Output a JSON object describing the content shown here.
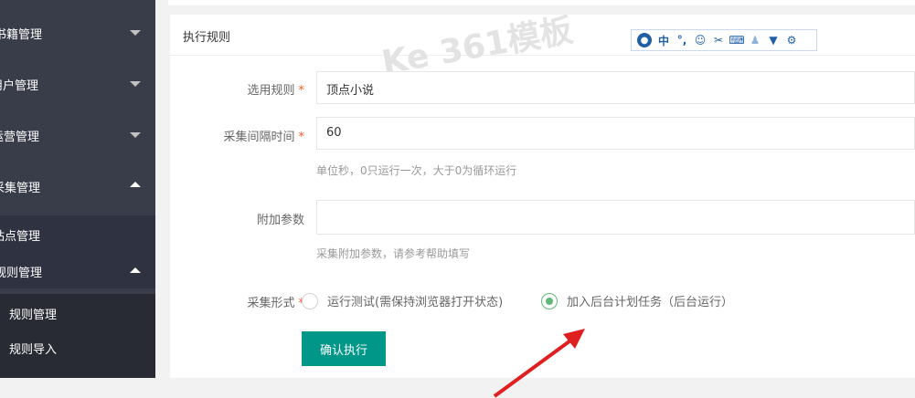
{
  "sidebar": {
    "items": [
      {
        "label": "书籍管理",
        "expanded": false
      },
      {
        "label": "用户管理",
        "expanded": false
      },
      {
        "label": "运营管理",
        "expanded": false
      },
      {
        "label": "采集管理",
        "expanded": true
      }
    ],
    "sub_items": [
      {
        "label": "站点管理"
      },
      {
        "label": "规则管理",
        "expanded": true
      }
    ],
    "nested_items": [
      {
        "label": "规则管理"
      },
      {
        "label": "规则导入"
      }
    ]
  },
  "card": {
    "title": "执行规则"
  },
  "watermark": "Ke 361模板",
  "toolbar": {
    "icons": [
      "avatar-icon",
      "chinese-char-icon",
      "punctuation-icon",
      "emoji-icon",
      "scissors-icon",
      "keyboard-icon",
      "user-icon",
      "shirt-icon",
      "gear-icon"
    ],
    "chars": {
      "chinese": "中"
    }
  },
  "form": {
    "rule_label": "选用规则",
    "rule_value": "顶点小说",
    "interval_label": "采集间隔时间",
    "interval_value": "60",
    "interval_help": "单位秒，0只运行一次，大于0为循环运行",
    "params_label": "附加参数",
    "params_value": "",
    "params_help": "采集附加参数，请参考帮助填写",
    "mode_label": "采集形式",
    "modes": [
      {
        "label": "运行测试(需保持浏览器打开状态)",
        "checked": false
      },
      {
        "label": "加入后台计划任务（后台运行）",
        "checked": true
      }
    ],
    "required_mark": "*",
    "submit_label": "确认执行"
  },
  "colors": {
    "sidebar": "#393d49",
    "accent": "#009688",
    "radio_checked": "#5fb878",
    "required": "#ff5722",
    "annotation_arrow": "#e02020"
  }
}
